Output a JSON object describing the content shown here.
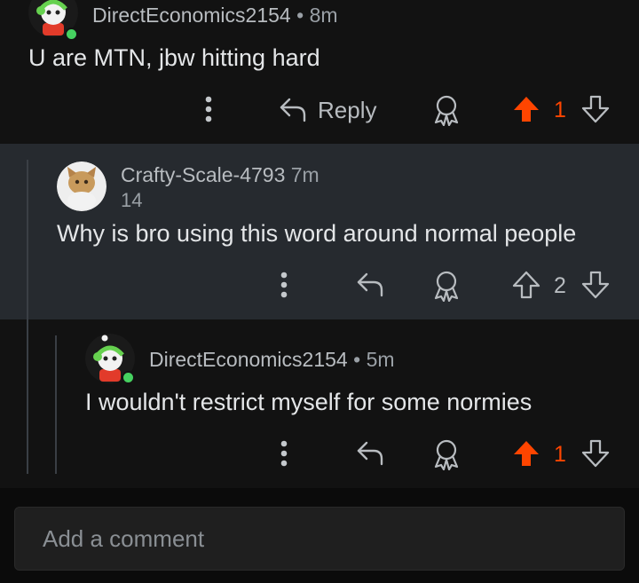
{
  "comments": [
    {
      "username": "DirectEconomics2154",
      "time": "8m",
      "separator": "•",
      "body": "U are MTN, jbw hitting hard",
      "reply_label": "Reply",
      "vote_count": "1",
      "upvoted": true,
      "online": true
    },
    {
      "username": "Crafty-Scale-4793",
      "time": "7m",
      "flair": "14",
      "body": "Why is bro using this word around normal people",
      "vote_count": "2",
      "upvoted": false,
      "online": false
    },
    {
      "username": "DirectEconomics2154",
      "time": "5m",
      "separator": "•",
      "body": "I wouldn't restrict myself for some normies",
      "vote_count": "1",
      "upvoted": true,
      "online": true
    }
  ],
  "composer": {
    "placeholder": "Add a comment"
  },
  "colors": {
    "upvote": "#ff4500",
    "online": "#46d160",
    "highlight_bg": "#262a2f",
    "page_bg": "#121212"
  },
  "icons": {
    "more": "more-vertical-icon",
    "reply": "reply-arrow-icon",
    "award": "award-icon",
    "upvote": "upvote-arrow-icon",
    "downvote": "downvote-arrow-icon"
  }
}
